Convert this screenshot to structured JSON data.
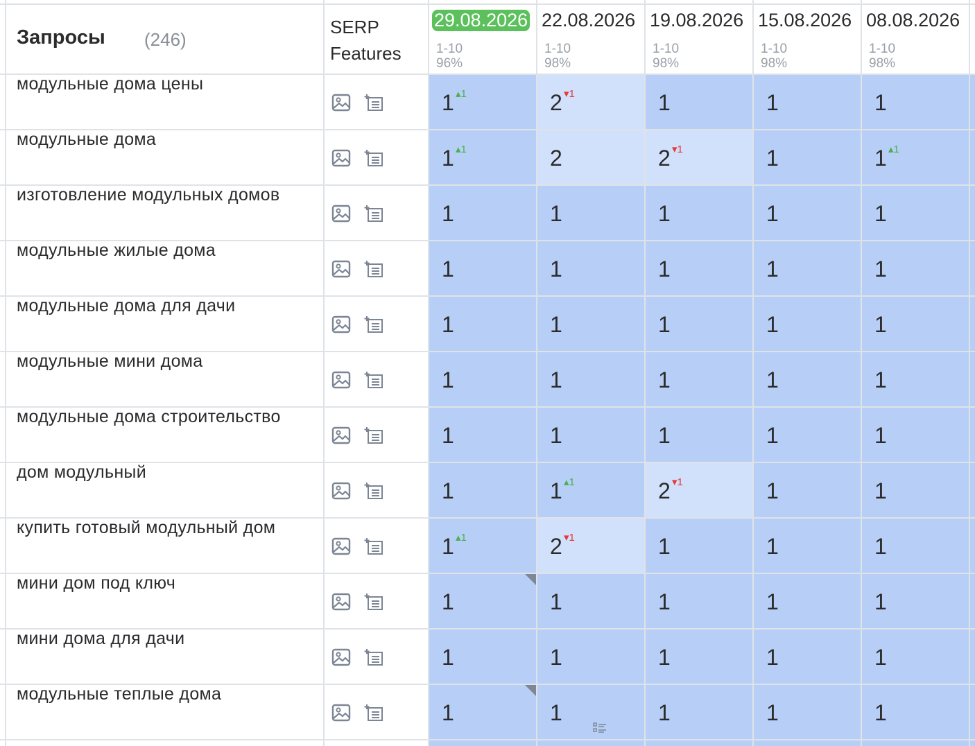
{
  "header": {
    "title": "Запросы",
    "count": "(246)",
    "serp_line1": "SERP",
    "serp_line2": "Features"
  },
  "dates": [
    {
      "date": "29.08.2026",
      "range": "1-10",
      "percent": "96%",
      "active": true
    },
    {
      "date": "22.08.2026",
      "range": "1-10",
      "percent": "98%"
    },
    {
      "date": "19.08.2026",
      "range": "1-10",
      "percent": "98%"
    },
    {
      "date": "15.08.2026",
      "range": "1-10",
      "percent": "98%"
    },
    {
      "date": "08.08.2026",
      "range": "1-10",
      "percent": "98%"
    }
  ],
  "icons": {
    "serp_image": "image-icon",
    "serp_list": "list-add-icon",
    "note": "list-note-icon"
  },
  "colors": {
    "cell_top": "#b7cff7",
    "cell_light": "#d1e0fb",
    "active_date": "#5cc05d",
    "delta_up": "#4caf50",
    "delta_down": "#e53935"
  },
  "rows": [
    {
      "keyword": "модульные дома цены",
      "cells": [
        {
          "pos": "1",
          "delta": "1",
          "dir": "up"
        },
        {
          "pos": "2",
          "delta": "1",
          "dir": "down",
          "light": true
        },
        {
          "pos": "1"
        },
        {
          "pos": "1"
        },
        {
          "pos": "1"
        }
      ]
    },
    {
      "keyword": "модульные дома",
      "cells": [
        {
          "pos": "1",
          "delta": "1",
          "dir": "up"
        },
        {
          "pos": "2",
          "light": true
        },
        {
          "pos": "2",
          "delta": "1",
          "dir": "down",
          "light": true
        },
        {
          "pos": "1"
        },
        {
          "pos": "1",
          "delta": "1",
          "dir": "up"
        }
      ]
    },
    {
      "keyword": "изготовление модульных домов",
      "cells": [
        {
          "pos": "1"
        },
        {
          "pos": "1"
        },
        {
          "pos": "1"
        },
        {
          "pos": "1"
        },
        {
          "pos": "1"
        }
      ]
    },
    {
      "keyword": "модульные жилые дома",
      "cells": [
        {
          "pos": "1"
        },
        {
          "pos": "1"
        },
        {
          "pos": "1"
        },
        {
          "pos": "1"
        },
        {
          "pos": "1"
        }
      ]
    },
    {
      "keyword": "модульные дома для дачи",
      "cells": [
        {
          "pos": "1"
        },
        {
          "pos": "1"
        },
        {
          "pos": "1"
        },
        {
          "pos": "1"
        },
        {
          "pos": "1"
        }
      ]
    },
    {
      "keyword": "модульные мини дома",
      "cells": [
        {
          "pos": "1"
        },
        {
          "pos": "1"
        },
        {
          "pos": "1"
        },
        {
          "pos": "1"
        },
        {
          "pos": "1"
        }
      ]
    },
    {
      "keyword": "модульные дома строительство",
      "cells": [
        {
          "pos": "1"
        },
        {
          "pos": "1"
        },
        {
          "pos": "1"
        },
        {
          "pos": "1"
        },
        {
          "pos": "1"
        }
      ]
    },
    {
      "keyword": "дом модульный",
      "cells": [
        {
          "pos": "1"
        },
        {
          "pos": "1",
          "delta": "1",
          "dir": "up"
        },
        {
          "pos": "2",
          "delta": "1",
          "dir": "down",
          "light": true
        },
        {
          "pos": "1"
        },
        {
          "pos": "1"
        }
      ]
    },
    {
      "keyword": "купить готовый модульный дом",
      "cells": [
        {
          "pos": "1",
          "delta": "1",
          "dir": "up"
        },
        {
          "pos": "2",
          "delta": "1",
          "dir": "down",
          "light": true
        },
        {
          "pos": "1"
        },
        {
          "pos": "1"
        },
        {
          "pos": "1"
        }
      ]
    },
    {
      "keyword": "мини дом под ключ",
      "cells": [
        {
          "pos": "1",
          "corner": true
        },
        {
          "pos": "1"
        },
        {
          "pos": "1"
        },
        {
          "pos": "1"
        },
        {
          "pos": "1"
        }
      ]
    },
    {
      "keyword": "мини дома для дачи",
      "cells": [
        {
          "pos": "1"
        },
        {
          "pos": "1"
        },
        {
          "pos": "1"
        },
        {
          "pos": "1"
        },
        {
          "pos": "1"
        }
      ]
    },
    {
      "keyword": "модульные теплые дома",
      "cells": [
        {
          "pos": "1",
          "corner": true
        },
        {
          "pos": "1",
          "note": true
        },
        {
          "pos": "1"
        },
        {
          "pos": "1"
        },
        {
          "pos": "1"
        }
      ]
    }
  ]
}
